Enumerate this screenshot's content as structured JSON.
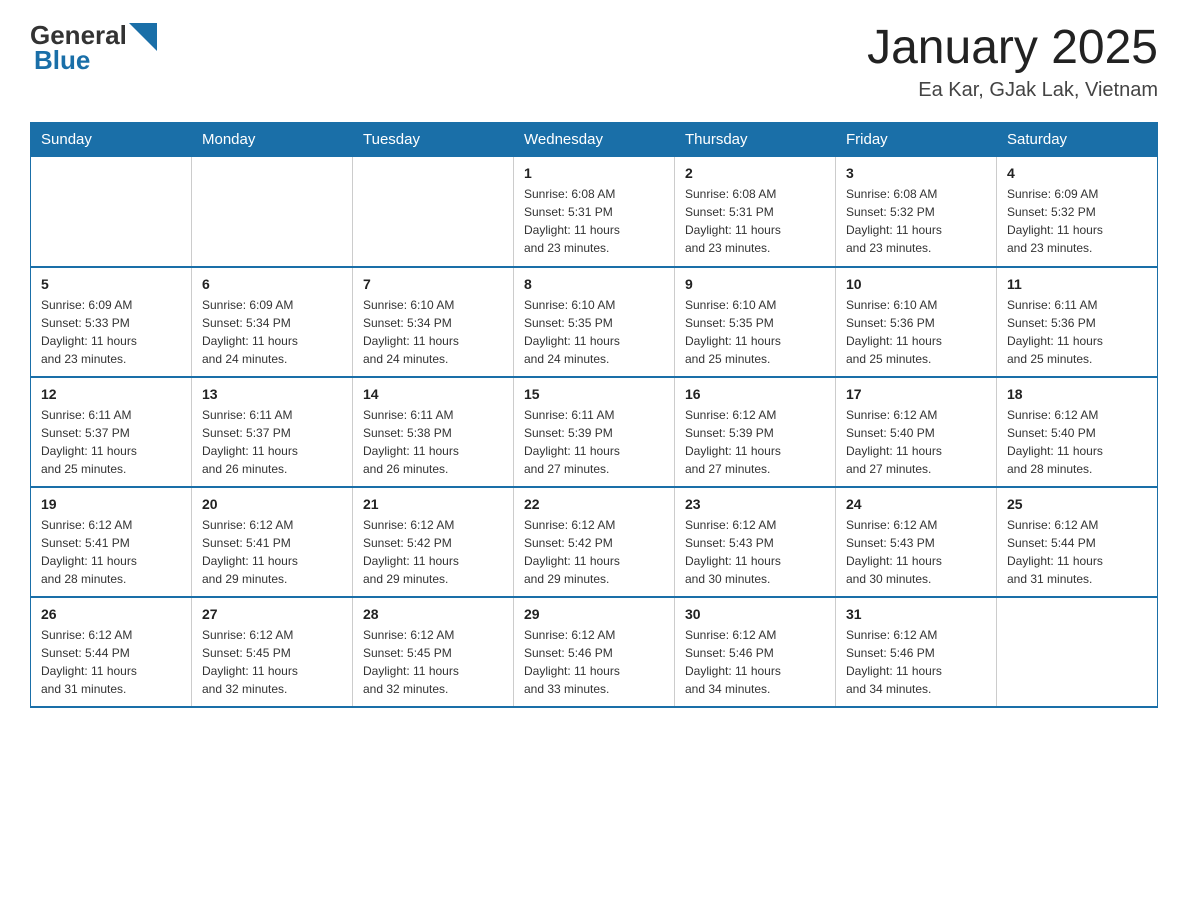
{
  "header": {
    "logo_general": "General",
    "logo_blue": "Blue",
    "title": "January 2025",
    "subtitle": "Ea Kar, GJak Lak, Vietnam"
  },
  "weekdays": [
    "Sunday",
    "Monday",
    "Tuesday",
    "Wednesday",
    "Thursday",
    "Friday",
    "Saturday"
  ],
  "weeks": [
    [
      {
        "day": "",
        "info": ""
      },
      {
        "day": "",
        "info": ""
      },
      {
        "day": "",
        "info": ""
      },
      {
        "day": "1",
        "info": "Sunrise: 6:08 AM\nSunset: 5:31 PM\nDaylight: 11 hours\nand 23 minutes."
      },
      {
        "day": "2",
        "info": "Sunrise: 6:08 AM\nSunset: 5:31 PM\nDaylight: 11 hours\nand 23 minutes."
      },
      {
        "day": "3",
        "info": "Sunrise: 6:08 AM\nSunset: 5:32 PM\nDaylight: 11 hours\nand 23 minutes."
      },
      {
        "day": "4",
        "info": "Sunrise: 6:09 AM\nSunset: 5:32 PM\nDaylight: 11 hours\nand 23 minutes."
      }
    ],
    [
      {
        "day": "5",
        "info": "Sunrise: 6:09 AM\nSunset: 5:33 PM\nDaylight: 11 hours\nand 23 minutes."
      },
      {
        "day": "6",
        "info": "Sunrise: 6:09 AM\nSunset: 5:34 PM\nDaylight: 11 hours\nand 24 minutes."
      },
      {
        "day": "7",
        "info": "Sunrise: 6:10 AM\nSunset: 5:34 PM\nDaylight: 11 hours\nand 24 minutes."
      },
      {
        "day": "8",
        "info": "Sunrise: 6:10 AM\nSunset: 5:35 PM\nDaylight: 11 hours\nand 24 minutes."
      },
      {
        "day": "9",
        "info": "Sunrise: 6:10 AM\nSunset: 5:35 PM\nDaylight: 11 hours\nand 25 minutes."
      },
      {
        "day": "10",
        "info": "Sunrise: 6:10 AM\nSunset: 5:36 PM\nDaylight: 11 hours\nand 25 minutes."
      },
      {
        "day": "11",
        "info": "Sunrise: 6:11 AM\nSunset: 5:36 PM\nDaylight: 11 hours\nand 25 minutes."
      }
    ],
    [
      {
        "day": "12",
        "info": "Sunrise: 6:11 AM\nSunset: 5:37 PM\nDaylight: 11 hours\nand 25 minutes."
      },
      {
        "day": "13",
        "info": "Sunrise: 6:11 AM\nSunset: 5:37 PM\nDaylight: 11 hours\nand 26 minutes."
      },
      {
        "day": "14",
        "info": "Sunrise: 6:11 AM\nSunset: 5:38 PM\nDaylight: 11 hours\nand 26 minutes."
      },
      {
        "day": "15",
        "info": "Sunrise: 6:11 AM\nSunset: 5:39 PM\nDaylight: 11 hours\nand 27 minutes."
      },
      {
        "day": "16",
        "info": "Sunrise: 6:12 AM\nSunset: 5:39 PM\nDaylight: 11 hours\nand 27 minutes."
      },
      {
        "day": "17",
        "info": "Sunrise: 6:12 AM\nSunset: 5:40 PM\nDaylight: 11 hours\nand 27 minutes."
      },
      {
        "day": "18",
        "info": "Sunrise: 6:12 AM\nSunset: 5:40 PM\nDaylight: 11 hours\nand 28 minutes."
      }
    ],
    [
      {
        "day": "19",
        "info": "Sunrise: 6:12 AM\nSunset: 5:41 PM\nDaylight: 11 hours\nand 28 minutes."
      },
      {
        "day": "20",
        "info": "Sunrise: 6:12 AM\nSunset: 5:41 PM\nDaylight: 11 hours\nand 29 minutes."
      },
      {
        "day": "21",
        "info": "Sunrise: 6:12 AM\nSunset: 5:42 PM\nDaylight: 11 hours\nand 29 minutes."
      },
      {
        "day": "22",
        "info": "Sunrise: 6:12 AM\nSunset: 5:42 PM\nDaylight: 11 hours\nand 29 minutes."
      },
      {
        "day": "23",
        "info": "Sunrise: 6:12 AM\nSunset: 5:43 PM\nDaylight: 11 hours\nand 30 minutes."
      },
      {
        "day": "24",
        "info": "Sunrise: 6:12 AM\nSunset: 5:43 PM\nDaylight: 11 hours\nand 30 minutes."
      },
      {
        "day": "25",
        "info": "Sunrise: 6:12 AM\nSunset: 5:44 PM\nDaylight: 11 hours\nand 31 minutes."
      }
    ],
    [
      {
        "day": "26",
        "info": "Sunrise: 6:12 AM\nSunset: 5:44 PM\nDaylight: 11 hours\nand 31 minutes."
      },
      {
        "day": "27",
        "info": "Sunrise: 6:12 AM\nSunset: 5:45 PM\nDaylight: 11 hours\nand 32 minutes."
      },
      {
        "day": "28",
        "info": "Sunrise: 6:12 AM\nSunset: 5:45 PM\nDaylight: 11 hours\nand 32 minutes."
      },
      {
        "day": "29",
        "info": "Sunrise: 6:12 AM\nSunset: 5:46 PM\nDaylight: 11 hours\nand 33 minutes."
      },
      {
        "day": "30",
        "info": "Sunrise: 6:12 AM\nSunset: 5:46 PM\nDaylight: 11 hours\nand 34 minutes."
      },
      {
        "day": "31",
        "info": "Sunrise: 6:12 AM\nSunset: 5:46 PM\nDaylight: 11 hours\nand 34 minutes."
      },
      {
        "day": "",
        "info": ""
      }
    ]
  ]
}
